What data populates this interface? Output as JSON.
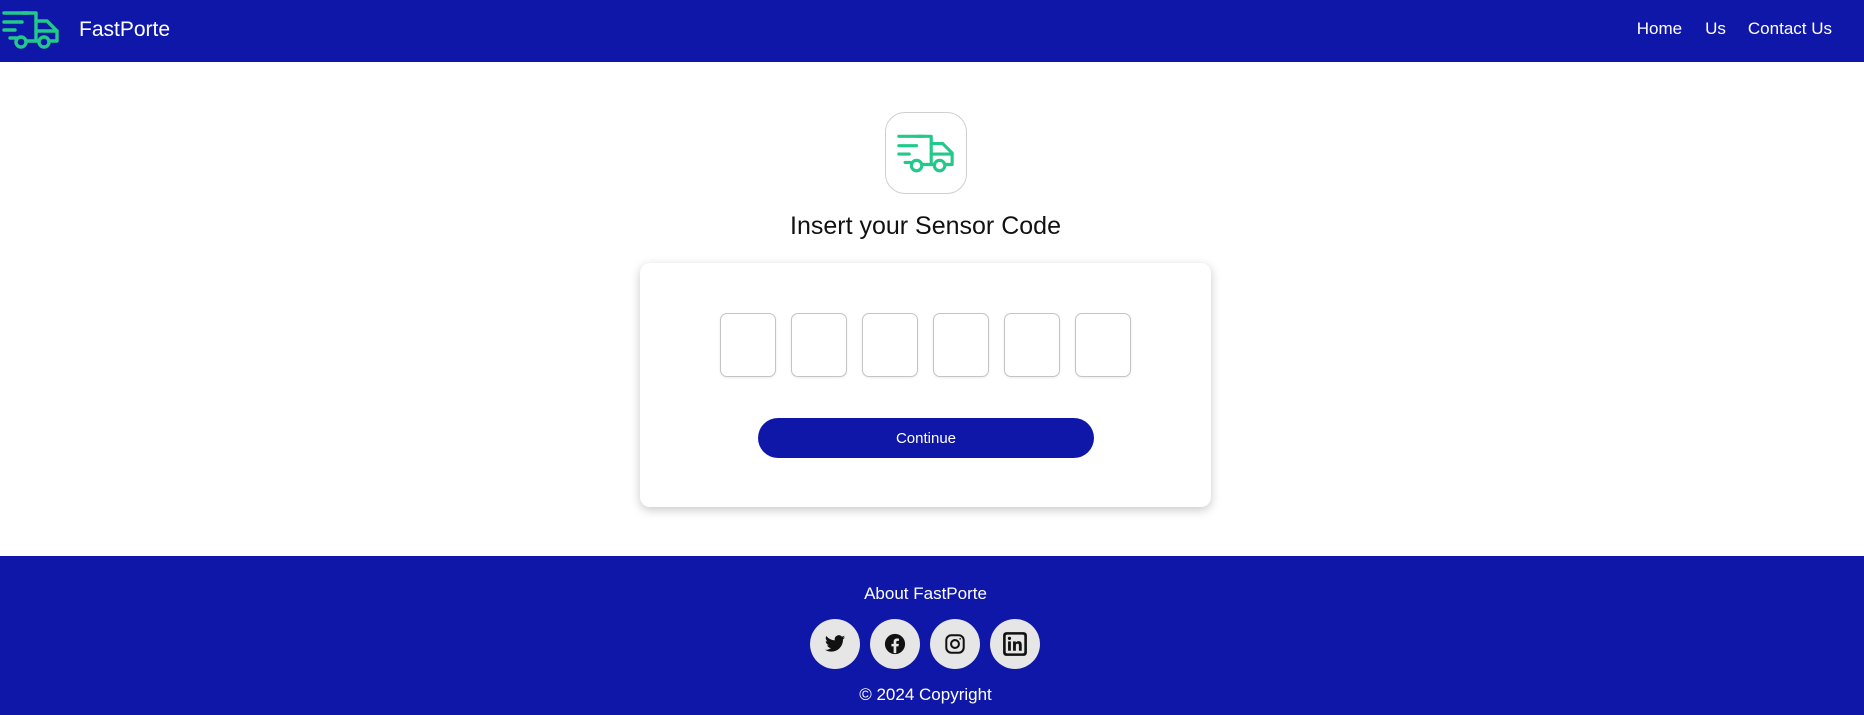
{
  "header": {
    "brand_name": "FastPorte",
    "nav": {
      "home": "Home",
      "us": "Us",
      "contact": "Contact Us"
    }
  },
  "main": {
    "title": "Insert your Sensor Code",
    "code_inputs": [
      "",
      "",
      "",
      "",
      "",
      ""
    ],
    "continue_label": "Continue"
  },
  "footer": {
    "about": "About FastPorte",
    "socials": [
      "twitter-icon",
      "facebook-icon",
      "instagram-icon",
      "linkedin-icon"
    ],
    "copyright": "© 2024 Copyright"
  },
  "colors": {
    "primary": "#0f17a8",
    "accent": "#22c98a",
    "social_bg": "#e6e6e6"
  }
}
